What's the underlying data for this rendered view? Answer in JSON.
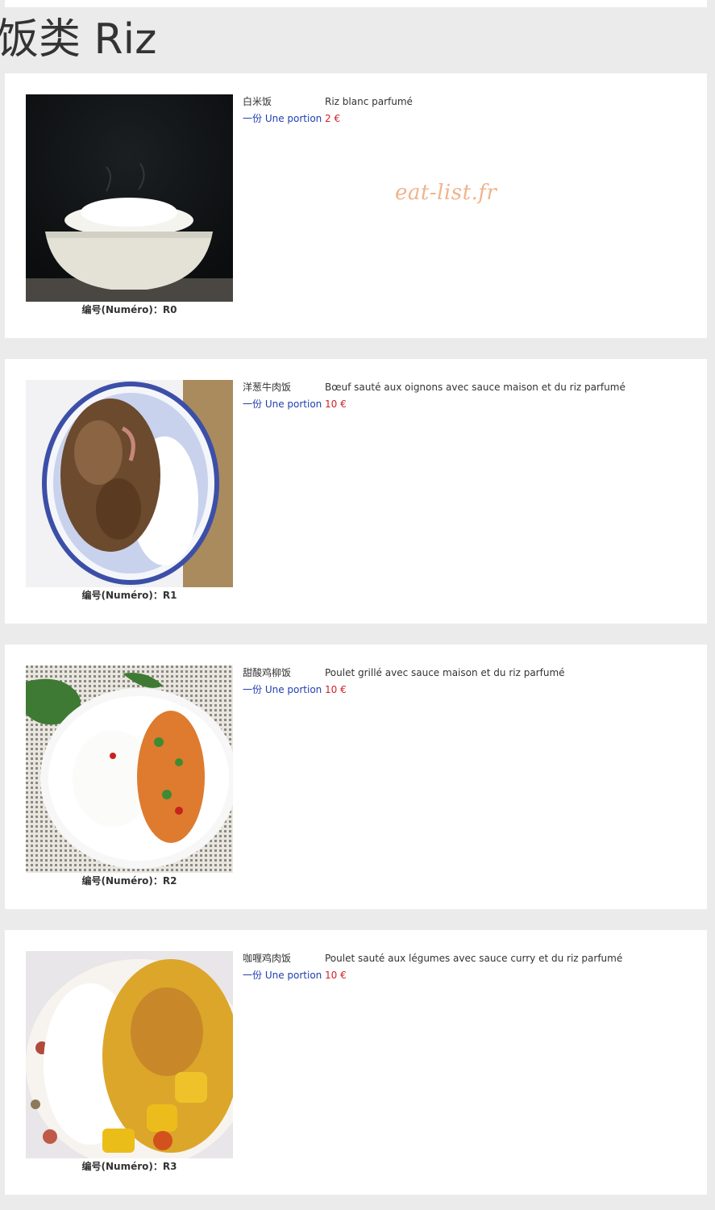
{
  "section_title": "饭类 Riz",
  "watermark": "eat-list.fr",
  "number_label": "编号(Numéro)：",
  "portion_label": "一份 Une portion",
  "items": [
    {
      "number": "R0",
      "name_zh": "白米饭",
      "desc_fr": "Riz blanc parfumé",
      "price": "2 €",
      "image": "plain-rice-bowl"
    },
    {
      "number": "R1",
      "name_zh": "洋葱牛肉饭",
      "desc_fr": "Bœuf sauté aux oignons avec sauce maison et du riz parfumé",
      "price": "10 €",
      "image": "beef-onion-rice"
    },
    {
      "number": "R2",
      "name_zh": "甜酸鸡柳饭",
      "desc_fr": "Poulet grillé avec sauce maison et du riz parfumé",
      "price": "10 €",
      "image": "sweet-sour-chicken-rice"
    },
    {
      "number": "R3",
      "name_zh": "咖喱鸡肉饭",
      "desc_fr": "Poulet sauté aux légumes avec sauce curry et du riz parfumé",
      "price": "10 €",
      "image": "curry-chicken-rice"
    }
  ]
}
